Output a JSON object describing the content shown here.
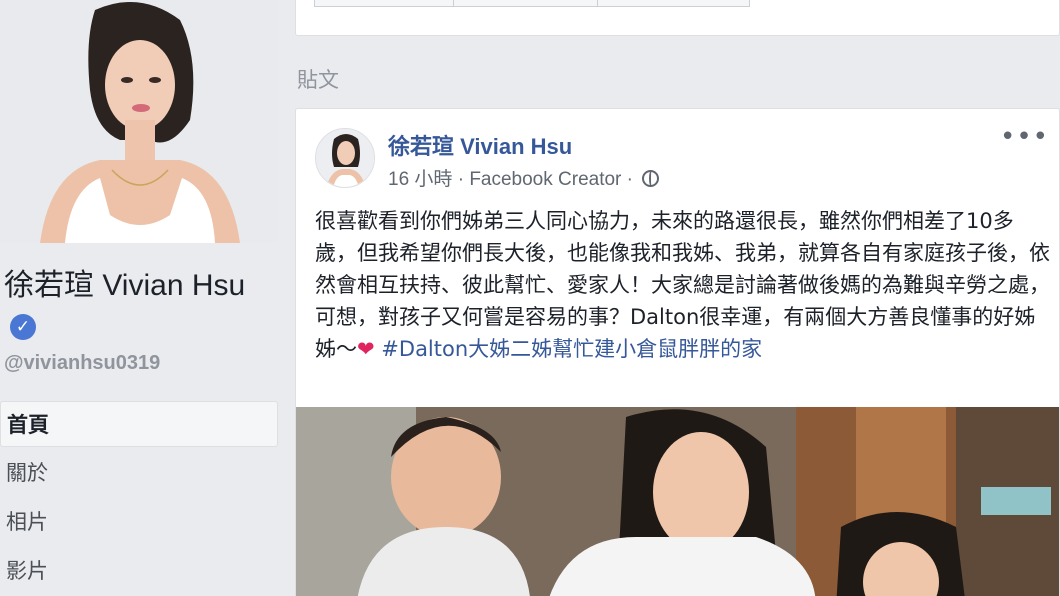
{
  "profile": {
    "name": "徐若瑄 Vivian Hsu",
    "username": "@vivianhsu0319",
    "verified_icon": "check-icon"
  },
  "nav": {
    "items": [
      {
        "label": "首頁",
        "active": true
      },
      {
        "label": "關於",
        "active": false
      },
      {
        "label": "相片",
        "active": false
      },
      {
        "label": "影片",
        "active": false
      }
    ]
  },
  "section": {
    "title": "貼文"
  },
  "post": {
    "author": "徐若瑄 Vivian Hsu",
    "time": "16 小時",
    "separator": "·",
    "via": "Facebook Creator",
    "more_label": "•••",
    "text_before": "很喜歡看到你們姊弟三人同心協力，未來的路還很長，雖然你們相差了10多歲，但我希望你們長大後，也能像我和我姊、我弟，就算各自有家庭孩子後，依然會相互扶持、彼此幫忙、愛家人！大家總是討論著做後媽的為難與辛勞之處，可想，對孩子又何嘗是容易的事？Dalton很幸運，有兩個大方善良懂事的好姊姊～",
    "heart": "❤",
    "hashtag": "#Dalton大姊二姊幫忙建小倉鼠胖胖的家"
  },
  "colors": {
    "link": "#365899",
    "meta": "#616770",
    "verified": "#4a76d4",
    "background": "#e9ebee"
  }
}
